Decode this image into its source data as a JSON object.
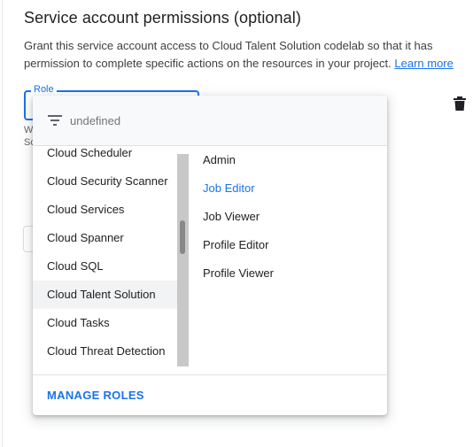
{
  "section": {
    "title": "Service account permissions (optional)",
    "description": "Grant this service account access to Cloud Talent Solution codelab so that it has permission to complete specific actions on the resources in your project.",
    "learn_more": "Learn more"
  },
  "role_field": {
    "label": "Role",
    "hint_line_1": "W",
    "hint_line_2": "Sc"
  },
  "delete_icon": "trash-icon",
  "menu": {
    "filter_placeholder": "undefined",
    "filter_icon": "filter-list-icon",
    "services": [
      {
        "label": "Cloud Scheduler",
        "selected": false
      },
      {
        "label": "Cloud Security Scanner",
        "selected": false
      },
      {
        "label": "Cloud Services",
        "selected": false
      },
      {
        "label": "Cloud Spanner",
        "selected": false
      },
      {
        "label": "Cloud SQL",
        "selected": false
      },
      {
        "label": "Cloud Talent Solution",
        "selected": true
      },
      {
        "label": "Cloud Tasks",
        "selected": false
      },
      {
        "label": "Cloud Threat Detection",
        "selected": false
      }
    ],
    "roles": [
      {
        "label": "Admin",
        "active": false
      },
      {
        "label": "Job Editor",
        "active": true
      },
      {
        "label": "Job Viewer",
        "active": false
      },
      {
        "label": "Profile Editor",
        "active": false
      },
      {
        "label": "Profile Viewer",
        "active": false
      }
    ],
    "manage_roles": "MANAGE ROLES"
  },
  "colors": {
    "accent": "#1a73e8",
    "selected_bg": "#f1f3f4",
    "text": "#202124",
    "muted": "#5f6368"
  }
}
